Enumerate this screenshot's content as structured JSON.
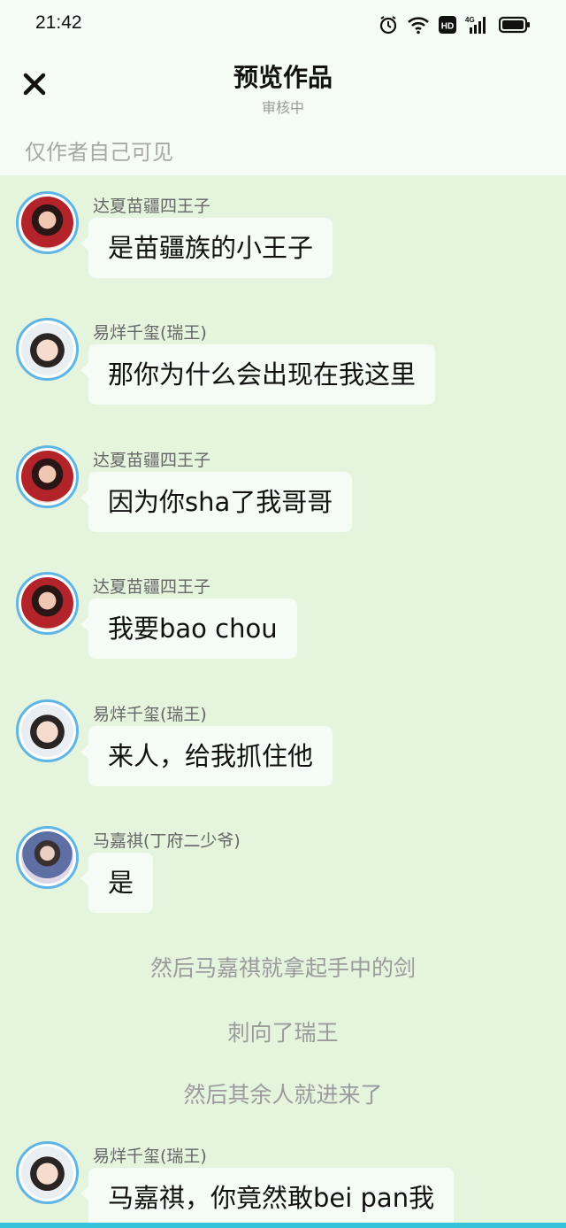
{
  "status_bar": {
    "time": "21:42",
    "icons": [
      "alarm-icon",
      "wifi-icon",
      "hd-icon",
      "signal-4g-icon",
      "battery-icon"
    ],
    "network_label": "4G",
    "hd_label": "HD"
  },
  "header": {
    "title": "预览作品",
    "subtitle": "审核中",
    "close_icon": "close-icon"
  },
  "visibility_note": "仅作者自己可见",
  "messages": [
    {
      "sender": "达夏苗疆四王子",
      "text": "是苗疆族的小王子",
      "avatar": "red"
    },
    {
      "sender": "易烊千玺(瑞王)",
      "text": "那你为什么会出现在我这里",
      "avatar": "white"
    },
    {
      "sender": "达夏苗疆四王子",
      "text": "因为你sha了我哥哥",
      "avatar": "red"
    },
    {
      "sender": "达夏苗疆四王子",
      "text": "我要bao chou",
      "avatar": "red"
    },
    {
      "sender": "易烊千玺(瑞王)",
      "text": "来人，给我抓住他",
      "avatar": "white"
    },
    {
      "sender": "马嘉祺(丁府二少爷)",
      "text": "是",
      "avatar": "blue"
    },
    {
      "sender": "易烊千玺(瑞王)",
      "text": "马嘉祺，你竟然敢bei pan我",
      "avatar": "white"
    }
  ],
  "narrations": [
    "然后马嘉祺就拿起手中的剑",
    "刺向了瑞王",
    "然后其余人就进来了"
  ],
  "colors": {
    "chat_background": "#e4f4dd",
    "bubble": "#f4fcf5",
    "avatar_ring": "#5fb6e6",
    "bottom_bar": "#35c3dc"
  }
}
